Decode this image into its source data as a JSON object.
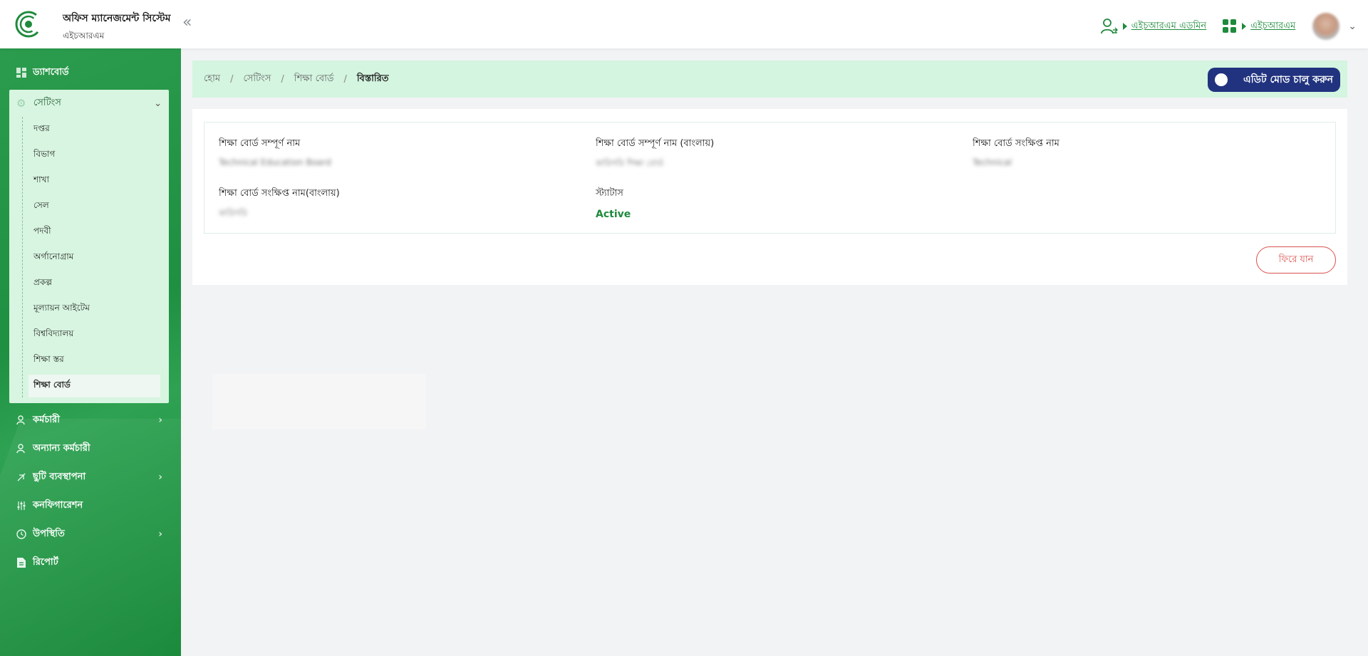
{
  "header": {
    "title": "অফিস ম্যানেজমেন্ট সিস্টেম",
    "subtitle": "এইচআরএম",
    "collapse_glyph": "«",
    "role_link": "এইচআরএম এডমিন",
    "app_link": "এইচআরএম",
    "colors": {
      "accent": "#1e8a3c",
      "logo": "#1e8a3c"
    }
  },
  "sidebar": {
    "items_top": [
      {
        "label": "ড্যাশবোর্ড",
        "icon": "dashboard-icon"
      }
    ],
    "settings": {
      "label": "সেটিংস",
      "icon": "gear-icon",
      "sub_items": [
        "দপ্তর",
        "বিভাগ",
        "শাখা",
        "সেল",
        "পদবী",
        "অর্গানোগ্রাম",
        "প্রকল্প",
        "মূল্যায়ন আইটেম",
        "বিশ্ববিদ্যালয়",
        "শিক্ষা স্তর",
        "শিক্ষা বোর্ড"
      ],
      "active_index": 10
    },
    "items_bottom": [
      {
        "label": "কর্মচারী",
        "icon": "users-icon",
        "has_children": true
      },
      {
        "label": "অন্যান্য কর্মচারী",
        "icon": "users-icon",
        "has_children": false
      },
      {
        "label": "ছুটি ব্যবস্থাপনা",
        "icon": "leave-icon",
        "has_children": true
      },
      {
        "label": "কনফিগারেশন",
        "icon": "sliders-icon",
        "has_children": false
      },
      {
        "label": "উপস্থিতি",
        "icon": "clock-icon",
        "has_children": true
      },
      {
        "label": "রিপোর্ট",
        "icon": "document-icon",
        "has_children": false
      }
    ],
    "colors": {
      "bg": "#1f8f41",
      "panel": "#d7f5e0"
    }
  },
  "breadcrumb": {
    "items": [
      "হোম",
      "সেটিংস",
      "শিক্ষা বোর্ড"
    ],
    "current": "বিস্তারিত",
    "separator": "/"
  },
  "edit_mode_button": {
    "label": "এডিট মোড চালু করুন",
    "color": "#21337f"
  },
  "details": {
    "full_name_label": "শিক্ষা বোর্ড সম্পূর্ণ নাম",
    "full_name_value": "Technical Education Board",
    "full_name_bn_label": "শিক্ষা বোর্ড সম্পূর্ণ নাম (বাংলায়)",
    "full_name_bn_value": "কারিগরি শিক্ষা বোর্ড",
    "short_name_label": "শিক্ষা বোর্ড সংক্ষিপ্ত নাম",
    "short_name_value": "Technical",
    "short_name_bn_label": "শিক্ষা বোর্ড সংক্ষিপ্ত নাম(বাংলায়)",
    "short_name_bn_value": "কারিগরি",
    "status_label": "স্ট্যাটাস",
    "status_value": "Active",
    "status_color": "#1e8a3c"
  },
  "back_button": {
    "label": "ফিরে যান",
    "color": "#d9534f"
  }
}
